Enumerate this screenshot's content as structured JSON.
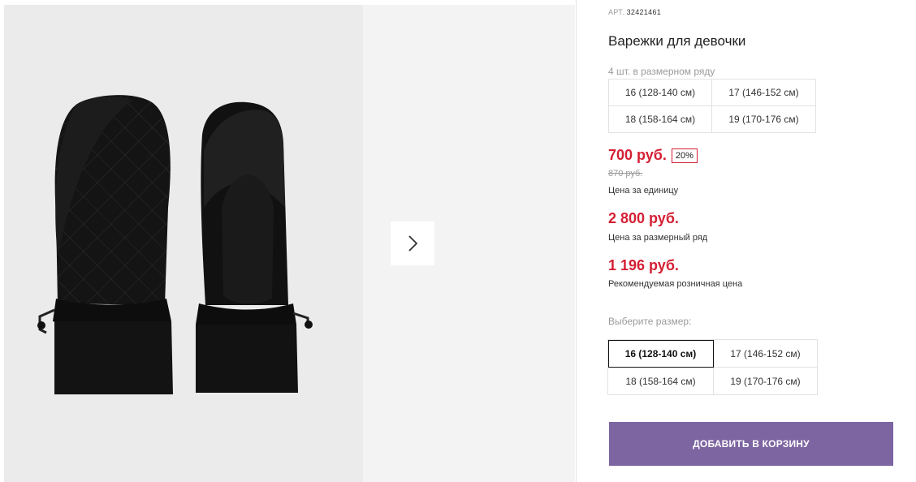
{
  "product": {
    "sku_label": "АРТ.",
    "sku_value": "32421461",
    "title": "Варежки для девочки",
    "pack_note": "4 шт. в размерном ряду"
  },
  "size_range": [
    "16 (128-140 см)",
    "17 (146-152 см)",
    "18 (158-164 см)",
    "19 (170-176 см)"
  ],
  "pricing": {
    "unit_price": "700 руб.",
    "discount": "20%",
    "old_price": "870 руб.",
    "unit_caption": "Цена за единицу",
    "row_price": "2 800 руб.",
    "row_caption": "Цена за размерный ряд",
    "retail_price": "1 196 руб.",
    "retail_caption": "Рекомендуемая розничная цена"
  },
  "size_picker": {
    "label": "Выберите размер:",
    "options": [
      "16 (128-140 см)",
      "17 (146-152 см)",
      "18 (158-164 см)",
      "19 (170-176 см)"
    ],
    "selected": "16 (128-140 см)"
  },
  "cart": {
    "button_label": "ДОБАВИТЬ В КОРЗИНУ"
  },
  "gallery": {
    "next_icon": "chevron-right-icon"
  },
  "colors": {
    "price_red": "#d51f34",
    "cart_purple": "#7d65a2",
    "photo_bg": "#ebebeb",
    "side_bg": "#f3f3f3"
  }
}
